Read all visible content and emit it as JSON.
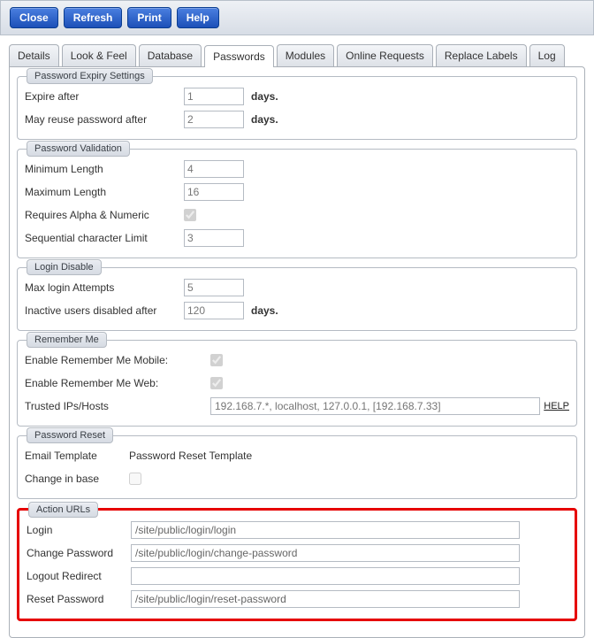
{
  "toolbar": {
    "close": "Close",
    "refresh": "Refresh",
    "print": "Print",
    "help": "Help"
  },
  "tabs": {
    "details": "Details",
    "look_feel": "Look & Feel",
    "database": "Database",
    "passwords": "Passwords",
    "modules": "Modules",
    "online_requests": "Online Requests",
    "replace_labels": "Replace Labels",
    "log": "Log"
  },
  "password_expiry": {
    "title": "Password Expiry Settings",
    "expire_after_label": "Expire after",
    "expire_after_value": "1",
    "expire_after_unit": "days.",
    "may_reuse_label": "May reuse password after",
    "may_reuse_value": "2",
    "may_reuse_unit": "days."
  },
  "password_validation": {
    "title": "Password Validation",
    "min_length_label": "Minimum Length",
    "min_length_value": "4",
    "max_length_label": "Maximum Length",
    "max_length_value": "16",
    "requires_alnum_label": "Requires Alpha & Numeric",
    "requires_alnum_checked": true,
    "seq_limit_label": "Sequential character Limit",
    "seq_limit_value": "3"
  },
  "login_disable": {
    "title": "Login Disable",
    "max_attempts_label": "Max login Attempts",
    "max_attempts_value": "5",
    "inactive_label": "Inactive users disabled after",
    "inactive_value": "120",
    "inactive_unit": "days."
  },
  "remember_me": {
    "title": "Remember Me",
    "mobile_label": "Enable Remember Me Mobile:",
    "mobile_checked": true,
    "web_label": "Enable Remember Me Web:",
    "web_checked": true,
    "trusted_label": "Trusted IPs/Hosts",
    "trusted_placeholder": "192.168.7.*, localhost, 127.0.0.1, [192.168.7.33]",
    "help_text": "HELP"
  },
  "password_reset": {
    "title": "Password Reset",
    "email_template_label": "Email Template",
    "email_template_value": "Password Reset Template",
    "change_in_base_label": "Change in base",
    "change_in_base_checked": false
  },
  "action_urls": {
    "title": "Action URLs",
    "login_label": "Login",
    "login_value": "/site/public/login/login",
    "change_pw_label": "Change Password",
    "change_pw_value": "/site/public/login/change-password",
    "logout_label": "Logout Redirect",
    "logout_value": "",
    "reset_pw_label": "Reset Password",
    "reset_pw_value": "/site/public/login/reset-password"
  }
}
